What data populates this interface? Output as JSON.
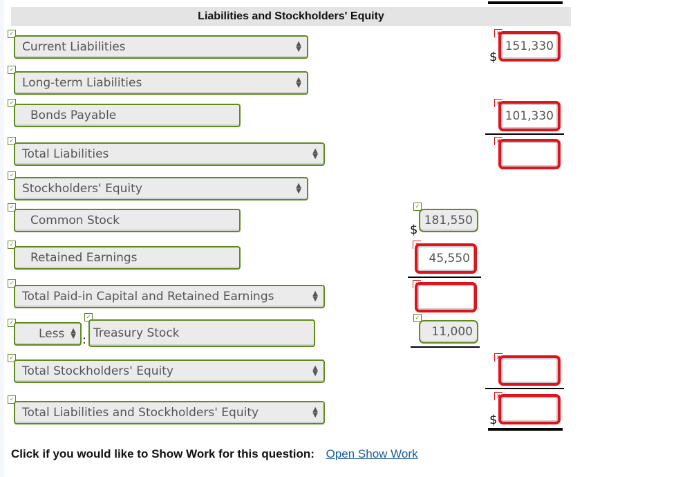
{
  "header": {
    "title": "Liabilities and Stockholders' Equity"
  },
  "status_icons": {
    "correct": "✓",
    "incorrect": "x"
  },
  "currency_symbol": "$",
  "rows": {
    "current_liabilities": {
      "label": "Current Liabilities",
      "type": "select",
      "status": "correct"
    },
    "long_term_liabilities": {
      "label": "Long-term Liabilities",
      "type": "select",
      "status": "correct"
    },
    "bonds_payable": {
      "label": "Bonds Payable",
      "type": "text",
      "status": "correct"
    },
    "total_liabilities": {
      "label": "Total Liabilities",
      "type": "select",
      "status": "correct"
    },
    "stockholders_equity": {
      "label": "Stockholders' Equity",
      "type": "select",
      "status": "correct"
    },
    "common_stock": {
      "label": "Common Stock",
      "type": "text",
      "status": "correct"
    },
    "retained_earnings": {
      "label": "Retained Earnings",
      "type": "text",
      "status": "correct"
    },
    "total_paid_in": {
      "label": "Total Paid-in Capital and Retained Earnings",
      "type": "select",
      "status": "correct"
    },
    "less_selector": {
      "label": "Less",
      "type": "select",
      "status": "correct"
    },
    "treasury_stock": {
      "label": "Treasury Stock",
      "type": "text",
      "status": "correct"
    },
    "total_stockholders_equity": {
      "label": "Total Stockholders' Equity",
      "type": "select",
      "status": "correct"
    },
    "total_liab_and_equity": {
      "label": "Total Liabilities and Stockholders' Equity",
      "type": "select",
      "status": "correct"
    }
  },
  "amounts": {
    "current_liabilities": {
      "value": "151,330",
      "status": "incorrect"
    },
    "bonds_payable": {
      "value": "101,330",
      "status": "incorrect"
    },
    "total_liabilities": {
      "value": "",
      "status": "incorrect"
    },
    "common_stock": {
      "value": "181,550",
      "status": "correct"
    },
    "retained_earnings": {
      "value": "45,550",
      "status": "incorrect"
    },
    "total_paid_in": {
      "value": "",
      "status": "incorrect"
    },
    "treasury_stock": {
      "value": "11,000",
      "status": "correct"
    },
    "total_stockholders_equity": {
      "value": "",
      "status": "incorrect"
    },
    "total_liab_and_equity": {
      "value": "",
      "status": "incorrect"
    }
  },
  "footer": {
    "prompt": "Click if you would like to Show Work for this question:",
    "link": "Open Show Work"
  }
}
